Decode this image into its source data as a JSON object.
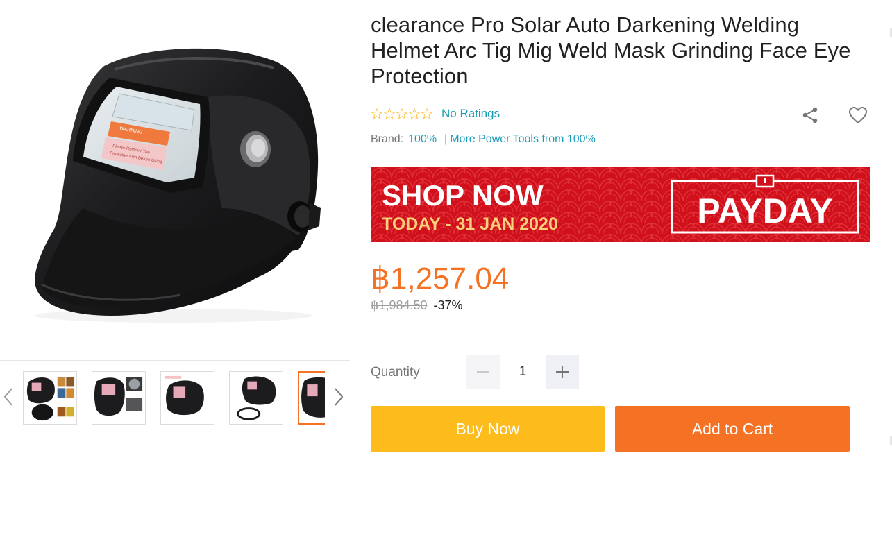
{
  "product": {
    "title": "clearance Pro Solar Auto Darkening Welding Helmet Arc Tig Mig Weld Mask Grinding Face Eye Protection",
    "rating_text": "No Ratings",
    "stars": 0,
    "brand_label": "Brand:",
    "brand_name": "100%",
    "brand_more": "More Power Tools from 100%",
    "price": "฿1,257.04",
    "original_price": "฿1,984.50",
    "discount": "-37%",
    "quantity_label": "Quantity",
    "quantity": "1",
    "buy_now_label": "Buy Now",
    "add_to_cart_label": "Add to Cart"
  },
  "banner": {
    "headline": "SHOP NOW",
    "dates": "TODAY - 31 JAN 2020",
    "campaign": "PAYDAY"
  },
  "gallery": {
    "thumbnail_count": 5,
    "active_index": 4
  },
  "icons": {
    "share": "share-icon",
    "wishlist": "heart-icon",
    "prev": "chevron-left-icon",
    "next": "chevron-right-icon",
    "minus": "minus-icon",
    "plus": "plus-icon"
  },
  "colors": {
    "accent": "#f57224",
    "buy_now": "#fdbb1c",
    "link": "#1a9cb7",
    "banner_red": "#d0101a"
  }
}
